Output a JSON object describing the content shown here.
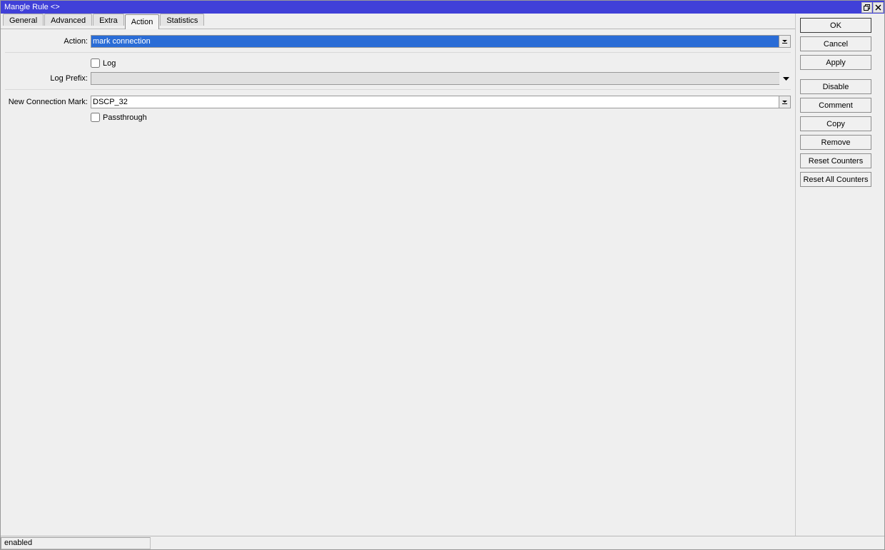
{
  "title": "Mangle Rule <>",
  "tabs": [
    "General",
    "Advanced",
    "Extra",
    "Action",
    "Statistics"
  ],
  "active_tab": "Action",
  "form": {
    "action_label": "Action:",
    "action_value": "mark connection",
    "log_label": "Log",
    "log_checked": false,
    "log_prefix_label": "Log Prefix:",
    "log_prefix_value": "",
    "new_conn_mark_label": "New Connection Mark:",
    "new_conn_mark_value": "DSCP_32",
    "passthrough_label": "Passthrough",
    "passthrough_checked": false
  },
  "buttons": {
    "ok": "OK",
    "cancel": "Cancel",
    "apply": "Apply",
    "disable": "Disable",
    "comment": "Comment",
    "copy": "Copy",
    "remove": "Remove",
    "reset_counters": "Reset Counters",
    "reset_all_counters": "Reset All Counters"
  },
  "status": "enabled"
}
